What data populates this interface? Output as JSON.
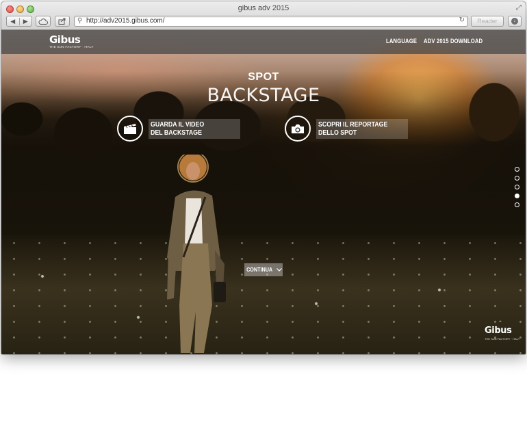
{
  "window": {
    "title": "gibus adv 2015"
  },
  "toolbar": {
    "url": "http://adv2015.gibus.com/",
    "reader_label": "Reader",
    "back_icon": "◀",
    "forward_icon": "▶"
  },
  "header": {
    "logo": "Gibus",
    "logo_tagline": "THE SUN FACTORY · ITALY",
    "nav": [
      {
        "label": "LANGUAGE"
      },
      {
        "label": "ADV 2015 DOWNLOAD"
      }
    ]
  },
  "hero": {
    "subtitle": "SPOT",
    "title": "BACKSTAGE",
    "ctas": [
      {
        "line1": "GUARDA IL VIDEO",
        "line2": "DEL BACKSTAGE",
        "icon": "clapperboard-icon"
      },
      {
        "line1": "SCOPRI IL REPORTAGE",
        "line2": "DELLO SPOT",
        "icon": "camera-icon"
      }
    ],
    "continue_label": "CONTINUA"
  },
  "pager": {
    "total": 5,
    "active_index": 3
  },
  "footer": {
    "logo": "Gibus",
    "logo_tagline": "THE SUN FACTORY · ITALY"
  },
  "colors": {
    "header_bg": "#464646",
    "text": "#ffffff"
  }
}
